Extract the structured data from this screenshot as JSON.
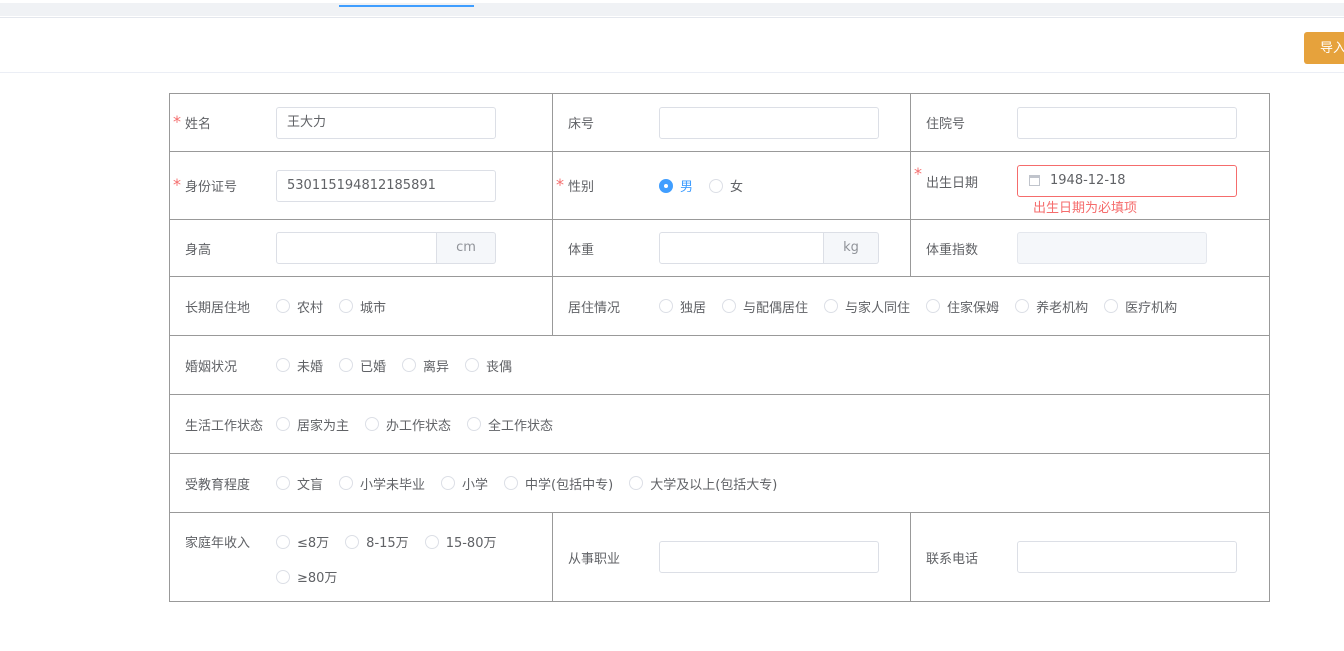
{
  "header": {
    "import_label": "导入"
  },
  "fields": {
    "name": {
      "label": "姓名",
      "value": "王大力"
    },
    "bed_no": {
      "label": "床号",
      "value": ""
    },
    "admission_no": {
      "label": "住院号",
      "value": ""
    },
    "id_no": {
      "label": "身份证号",
      "value": "530115194812185891"
    },
    "gender": {
      "label": "性别",
      "options": [
        "男",
        "女"
      ],
      "selected": "男"
    },
    "birth_date": {
      "label": "出生日期",
      "value": "1948-12-18",
      "error": "出生日期为必填项"
    },
    "height": {
      "label": "身高",
      "value": "",
      "unit": "cm"
    },
    "weight": {
      "label": "体重",
      "value": "",
      "unit": "kg"
    },
    "bmi": {
      "label": "体重指数",
      "value": ""
    },
    "residence": {
      "label": "长期居住地",
      "options": [
        "农村",
        "城市"
      ]
    },
    "living": {
      "label": "居住情况",
      "options": [
        "独居",
        "与配偶居住",
        "与家人同住",
        "住家保姆",
        "养老机构",
        "医疗机构"
      ]
    },
    "marital": {
      "label": "婚姻状况",
      "options": [
        "未婚",
        "已婚",
        "离异",
        "丧偶"
      ]
    },
    "work": {
      "label": "生活工作状态",
      "options": [
        "居家为主",
        "办工作状态",
        "全工作状态"
      ]
    },
    "education": {
      "label": "受教育程度",
      "options": [
        "文盲",
        "小学未毕业",
        "小学",
        "中学(包括中专)",
        "大学及以上(包括大专)"
      ]
    },
    "income": {
      "label": "家庭年收入",
      "options": [
        "≤8万",
        "8-15万",
        "15-80万",
        "≥80万"
      ]
    },
    "occupation": {
      "label": "从事职业",
      "value": ""
    },
    "phone": {
      "label": "联系电话",
      "value": ""
    }
  },
  "colors": {
    "accent": "#409eff",
    "error": "#f56c6c",
    "import_button": "#e6a23c"
  }
}
